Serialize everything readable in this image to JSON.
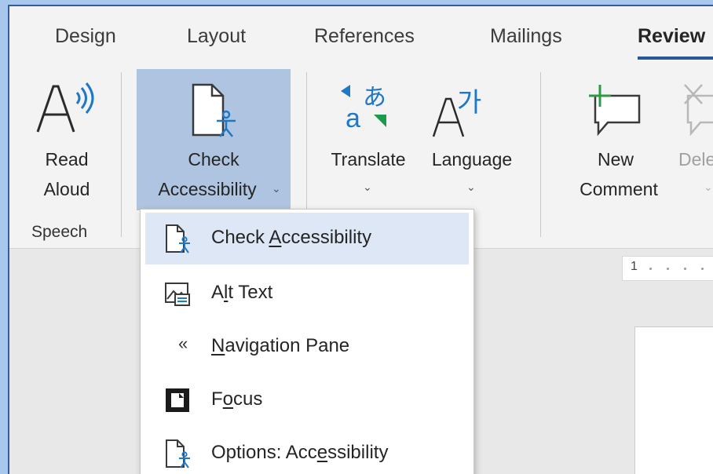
{
  "tabs": [
    {
      "label": "Design",
      "active": false
    },
    {
      "label": "Layout",
      "active": false
    },
    {
      "label": "References",
      "active": false
    },
    {
      "label": "Mailings",
      "active": false
    },
    {
      "label": "Review",
      "active": true
    }
  ],
  "ribbon": {
    "read_aloud": {
      "line1": "Read",
      "line2": "Aloud",
      "group": "Speech"
    },
    "check_accessibility": {
      "line1": "Check",
      "line2": "Accessibility",
      "chevron": "⌄"
    },
    "translate": {
      "label": "Translate",
      "chevron": "⌄"
    },
    "language": {
      "label": "Language",
      "chevron": "⌄"
    },
    "new_comment": {
      "line1": "New",
      "line2": "Comment"
    },
    "delete": {
      "label": "Dele",
      "chevron": "⌄"
    }
  },
  "ruler": {
    "number": "1"
  },
  "menu": {
    "items": [
      {
        "pre": "Check ",
        "key": "A",
        "post": "ccessibility",
        "icon": "check-accessibility-icon",
        "hover": true
      },
      {
        "pre": "A",
        "key": "l",
        "post": "t Text",
        "icon": "alt-text-icon",
        "hover": false
      },
      {
        "pre": "",
        "key": "N",
        "post": "avigation Pane",
        "icon": "navigation-pane-icon",
        "hover": false
      },
      {
        "pre": "F",
        "key": "o",
        "post": "cus",
        "icon": "focus-icon",
        "hover": false
      },
      {
        "pre": "Options: Acc",
        "key": "e",
        "post": "ssibility",
        "icon": "options-accessibility-icon",
        "hover": false
      }
    ],
    "nav_glyph": "«"
  },
  "colors": {
    "outer_background": "#a9c6ec",
    "ribbon_background": "#f3f3f3",
    "highlight": "#aec4e0",
    "menu_hover": "#dde7f5",
    "accent_blue": "#2b579a",
    "translate_blue": "#1e78c8",
    "translate_green": "#1a9a4a",
    "comment_green": "#2e9a48"
  }
}
